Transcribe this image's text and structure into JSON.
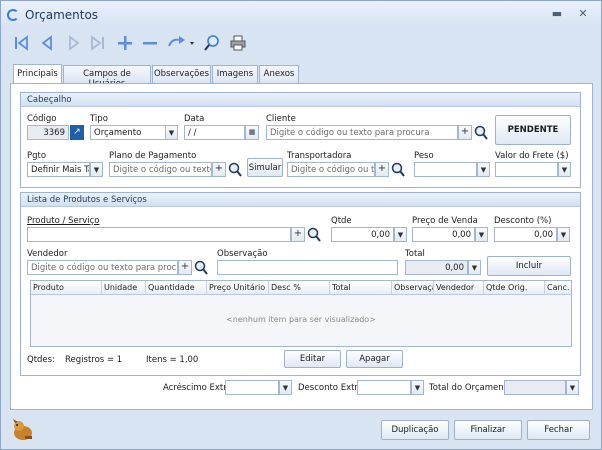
{
  "window": {
    "title": "Orçamentos"
  },
  "tabs": [
    "Principais",
    "Campos de Usuários",
    "Observações",
    "Imagens",
    "Anexos"
  ],
  "header": {
    "group_title": "Cabeçalho",
    "codigo_label": "Código",
    "codigo_value": "3369",
    "tipo_label": "Tipo",
    "tipo_value": "Orçamento",
    "data_label": "Data",
    "data_value": " / /",
    "cliente_label": "Cliente",
    "cliente_placeholder": "Digite o código ou texto para procura",
    "status": "PENDENTE",
    "pgto_label": "Pgto",
    "pgto_value": "Definir Mais Tarde",
    "plano_label": "Plano de Pagamento",
    "plano_placeholder": "Digite o código ou texto para procura",
    "simular_label": "Simular",
    "transp_label": "Transportadora",
    "transp_placeholder": "Digite o código ou texto para procura",
    "peso_label": "Peso",
    "frete_label": "Valor do Frete ($)"
  },
  "products": {
    "group_title": "Lista de Produtos e Serviços",
    "produto_label": "Produto / Serviço",
    "qtde_label": "Qtde",
    "qtde_value": "0,00",
    "preco_label": "Preço de Venda",
    "preco_value": "0,00",
    "desconto_label": "Desconto (%)",
    "desconto_value": "0,00",
    "vendedor_label": "Vendedor",
    "vendedor_placeholder": "Digite o código ou texto para procura",
    "obs_label": "Observação",
    "total_label": "Total",
    "total_value": "0,00",
    "incluir_label": "Incluir",
    "columns": [
      "Produto",
      "Unidade",
      "Quantidade",
      "Preço Unitário",
      "Desc %",
      "Total",
      "Observação",
      "Vendedor",
      "Qtde Orig.",
      "Canc."
    ],
    "empty_text": "<nenhum item para ser visualizado>",
    "qtdes_label": "Qtdes:",
    "registros_text": "Registros = 1",
    "itens_text": "Itens = 1,00",
    "editar_label": "Editar",
    "apagar_label": "Apagar"
  },
  "totals": {
    "acrescimo_label": "Acréscimo Extra",
    "desconto_label": "Desconto Extra",
    "total_label": "Total do Orçamento"
  },
  "footer": {
    "duplicacao_label": "Duplicação",
    "finalizar_label": "Finalizar",
    "fechar_label": "Fechar"
  },
  "colors": {
    "accent": "#3b7bd1",
    "toolbar_icon": "#5b8ee0"
  },
  "icons": [
    "first-record-icon",
    "previous-record-icon",
    "next-record-icon",
    "last-record-icon",
    "add-icon",
    "remove-icon",
    "refresh-icon",
    "search-icon",
    "print-icon"
  ]
}
